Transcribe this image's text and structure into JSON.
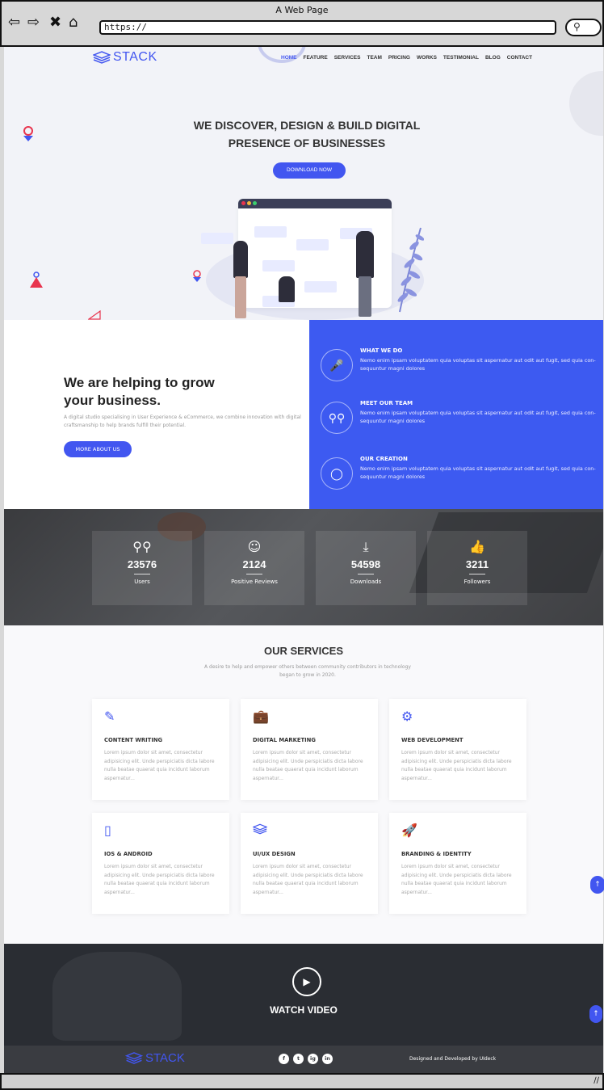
{
  "window": {
    "title": "A Web Page",
    "url": "https://",
    "search_icon": "search-icon"
  },
  "nav": {
    "logo": "STACK",
    "items": [
      "HOME",
      "FEATURE",
      "SERVICES",
      "TEAM",
      "PRICING",
      "WORKS",
      "TESTIMONIAL",
      "BLOG",
      "CONTACT"
    ],
    "active": "HOME"
  },
  "hero": {
    "title_line1": "WE DISCOVER, DESIGN & BUILD DIGITAL",
    "title_line2": "PRESENCE OF BUSINESSES",
    "cta": "DOWNLOAD NOW"
  },
  "about": {
    "title_line1": "We are helping to grow",
    "title_line2": "your business.",
    "desc": "A digital studio specialising in User Experience & eCommerce, we combine innovation with digital craftsmanship to help brands fulfill their potential.",
    "button": "MORE ABOUT US"
  },
  "features": [
    {
      "title": "WHAT WE DO",
      "text": "Nemo enim ipsam voluptatem quia voluptas sit aspernatur aut odit aut fugit, sed quia con- sequuntur magni dolores",
      "icon": "microphone-icon"
    },
    {
      "title": "MEET OUR TEAM",
      "text": "Nemo enim ipsam voluptatem quia voluptas sit aspernatur aut odit aut fugit, sed quia con- sequuntur magni dolores",
      "icon": "users-icon"
    },
    {
      "title": "OUR CREATION",
      "text": "Nemo enim ipsam voluptatem quia voluptas sit aspernatur aut odit aut fugit, sed quia con- sequuntur magni dolores",
      "icon": "award-icon"
    }
  ],
  "stats": [
    {
      "value": "23576",
      "label": "Users",
      "icon": "users-icon"
    },
    {
      "value": "2124",
      "label": "Positive Reviews",
      "icon": "smile-icon"
    },
    {
      "value": "54598",
      "label": "Downloads",
      "icon": "download-icon"
    },
    {
      "value": "3211",
      "label": "Followers",
      "icon": "thumbs-up-icon"
    }
  ],
  "services": {
    "title": "OUR SERVICES",
    "subtitle_line1": "A desire to help and empower others between community contributors in technology",
    "subtitle_line2": "began to grow in 2020.",
    "items": [
      {
        "name": "CONTENT WRITING",
        "icon": "pencil-icon",
        "text": "Lorem ipsum dolor sit amet, consectetur adipisicing elit. Unde perspiciatis dicta labore nulla beatae quaerat quia incidunt laborum aspernatur..."
      },
      {
        "name": "DIGITAL MARKETING",
        "icon": "briefcase-icon",
        "text": "Lorem ipsum dolor sit amet, consectetur adipisicing elit. Unde perspiciatis dicta labore nulla beatae quaerat quia incidunt laborum aspernatur..."
      },
      {
        "name": "WEB DEVELOPMENT",
        "icon": "gear-icon",
        "text": "Lorem ipsum dolor sit amet, consectetur adipisicing elit. Unde perspiciatis dicta labore nulla beatae quaerat quia incidunt laborum aspernatur..."
      },
      {
        "name": "IOS & ANDROID",
        "icon": "mobile-icon",
        "text": "Lorem ipsum dolor sit amet, consectetur adipisicing elit. Unde perspiciatis dicta labore nulla beatae quaerat quia incidunt laborum aspernatur..."
      },
      {
        "name": "UI/UX DESIGN",
        "icon": "layers-icon",
        "text": "Lorem ipsum dolor sit amet, consectetur adipisicing elit. Unde perspiciatis dicta labore nulla beatae quaerat quia incidunt laborum aspernatur..."
      },
      {
        "name": "BRANDING & IDENTITY",
        "icon": "rocket-icon",
        "text": "Lorem ipsum dolor sit amet, consectetur adipisicing elit. Unde perspiciatis dicta labore nulla beatae quaerat quia incidunt laborum aspernatur..."
      }
    ]
  },
  "video": {
    "label": "WATCH VIDEO",
    "icon": "play-icon"
  },
  "footer": {
    "logo": "STACK",
    "socials": [
      "f",
      "t",
      "ig",
      "in"
    ],
    "credit": "Designed and Developed by UIdeck"
  },
  "colors": {
    "accent": "#4256f0",
    "feature_bg": "#3d5af1",
    "footer_bg": "#3a3c41"
  }
}
